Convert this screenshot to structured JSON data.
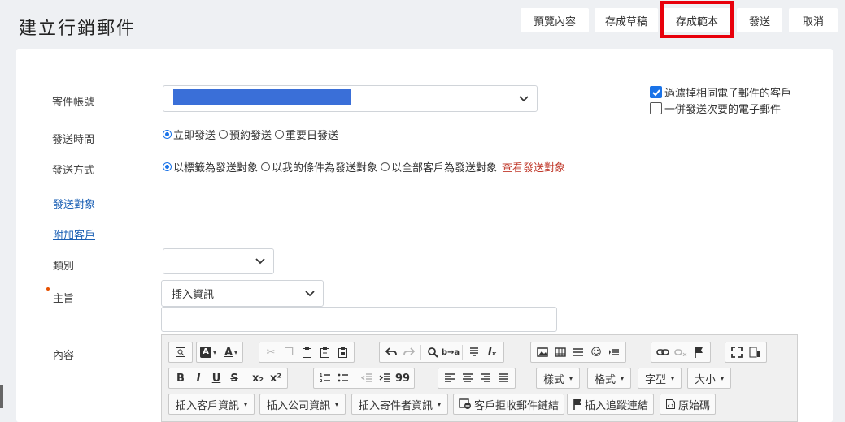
{
  "page": {
    "title": "建立行銷郵件"
  },
  "top_actions": {
    "preview": "預覽內容",
    "save_draft": "存成草稿",
    "save_template": "存成範本",
    "send": "發送",
    "cancel": "取消"
  },
  "form": {
    "sender_label": "寄件帳號",
    "send_time_label": "發送時間",
    "send_time_options": [
      "立即發送",
      "預約發送",
      "重要日發送"
    ],
    "send_time_selected": 0,
    "send_method_label": "發送方式",
    "send_method_options": [
      "以標籤為發送對象",
      "以我的條件為發送對象",
      "以全部客戶為發送對象"
    ],
    "send_method_selected": 0,
    "view_targets_link": "查看發送對象",
    "targets_link": "發送對象",
    "add_customer_link": "附加客戶",
    "category_label": "類別",
    "category_value": "",
    "subject_label": "主旨",
    "insert_info_select": "插入資訊",
    "subject_value": "",
    "content_label": "內容"
  },
  "options": {
    "filter_duplicate": {
      "label": "過濾掉相同電子郵件的客戶",
      "checked": true
    },
    "send_secondary": {
      "label": "一併發送次要的電子郵件",
      "checked": false
    }
  },
  "editor_toolbar": {
    "row2_dropdowns": [
      "樣式",
      "格式",
      "字型",
      "大小"
    ],
    "row3_buttons": [
      "插入客戶資訊",
      "插入公司資訊",
      "插入寄件者資訊",
      "客戶拒收郵件鏈結",
      "插入追蹤連結",
      "原始碼"
    ],
    "glyphs": {
      "bold": "B",
      "italic": "I",
      "underline": "U",
      "strike": "S",
      "subscript": "x₂",
      "superscript": "x²",
      "quote": "99",
      "text_color": "A"
    }
  },
  "colors": {
    "accent": "#1a73e8",
    "highlight": "#e8000b",
    "sender_redaction": "#3a6fd8",
    "view_link": "#c0392b",
    "link": "#1a5fb4"
  }
}
